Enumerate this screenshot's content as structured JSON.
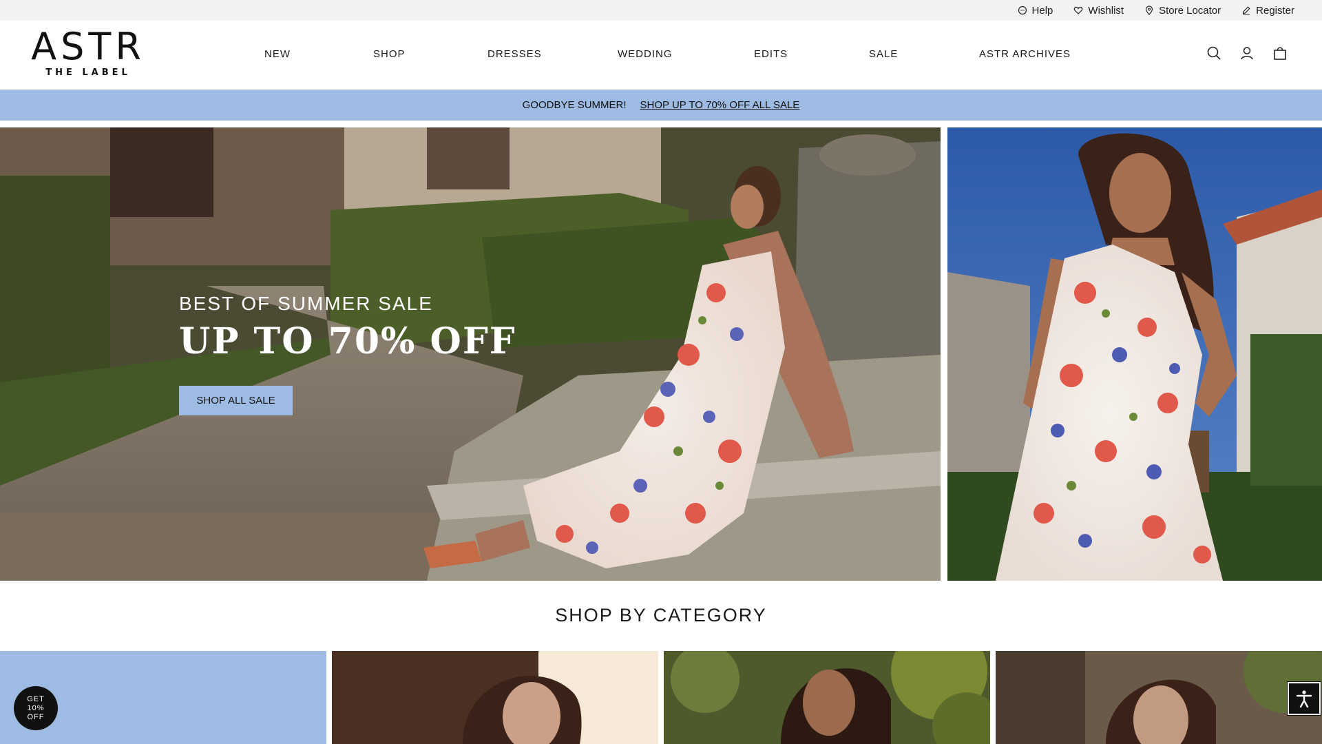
{
  "utility": {
    "help": "Help",
    "wishlist": "Wishlist",
    "store_locator": "Store Locator",
    "register": "Register"
  },
  "logo": {
    "main": "ASTR",
    "sub": "THE LABEL"
  },
  "nav": [
    "NEW",
    "SHOP",
    "DRESSES",
    "WEDDING",
    "EDITS",
    "SALE",
    "ASTR ARCHIVES"
  ],
  "header_icons": [
    "search-icon",
    "account-icon",
    "bag-icon"
  ],
  "promo": {
    "text": "GOODBYE SUMMER!",
    "link": "SHOP UP TO 70% OFF ALL SALE"
  },
  "hero": {
    "kicker": "BEST OF SUMMER SALE",
    "headline": "UP TO 70% OFF",
    "cta": "SHOP ALL SALE"
  },
  "category": {
    "title": "SHOP BY CATEGORY"
  },
  "badge": {
    "line1": "GET",
    "line2": "10%",
    "line3": "OFF"
  },
  "colors": {
    "accent": "#9dbbe3",
    "utility_bg": "#f2f2f2",
    "text": "#1a1a1a"
  }
}
